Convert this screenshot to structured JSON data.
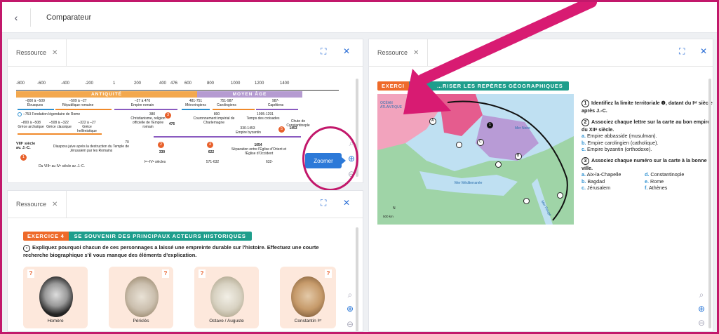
{
  "topbar": {
    "back_icon": "chevron-left-icon",
    "title": "Comparateur"
  },
  "tab_label": "Ressource",
  "tab_close": "✕",
  "zoom_button_label": "Zoomer",
  "timeline": {
    "ticks": [
      "-800",
      "-600",
      "-400",
      "-200",
      "1",
      "200",
      "400",
      "476",
      "600",
      "800",
      "1000",
      "1200",
      "1400"
    ],
    "period_antiquite": "ANTIQUITÉ",
    "period_moyen_age": "MOYEN ÂGE",
    "ranges": [
      {
        "dates": "–800 à –509",
        "label": "Étrusques"
      },
      {
        "dates": "–509 à –27",
        "label": "République romaine"
      },
      {
        "dates": "–27 à 476",
        "label": "Empire romain"
      },
      {
        "dates": "481-751",
        "label": "Mérovingiens"
      },
      {
        "dates": "751-987",
        "label": "Carolingiens"
      },
      {
        "dates": "987-",
        "label": "Capétiens"
      }
    ],
    "events": {
      "rome": "–753 Fondation légendaire de Rome",
      "greece_a": "–800 à –508",
      "greece_a_label": "Grèce archaïque",
      "greece_c": "–508 à –322",
      "greece_c_label": "Grèce classique",
      "greece_h": "–322 à –27",
      "greece_h_label": "Grèce hellénistique",
      "y380": "380",
      "christianisme": "Christianisme, religion officielle de l'Empire romain",
      "y476": "476",
      "y800": "800",
      "couronnement": "Couronnement impérial de Charlemagne",
      "crusades": "1095-1291",
      "crusades_label": "Temps des croisades",
      "byz": "330-1453",
      "byz_label": "Empire byzantin",
      "y1453": "1453",
      "constantinople": "Chute de Constantinople",
      "viii": "VIIIᵉ siècle av. J.-C.",
      "y70": "70",
      "diaspora": "Diaspora juive après la destruction du Temple de Jérusalem par les Romains",
      "y330": "330",
      "y622": "622",
      "y1054": "1054",
      "schisme": "Séparation entre l'Église d'Orient et l'Église d'Occident",
      "n1": "1",
      "n2": "2",
      "n3": "3",
      "n4": "4",
      "n5": "5",
      "bottom1": "Du VIIIᵉ au IVᵉ siècle av. J.-C.",
      "bottom2": "Iᵉʳ–IVᵉ siècles",
      "bottom3": "571-632",
      "bottom4": "632-"
    }
  },
  "exercise4": {
    "num": "EXERCICE 4",
    "title": "SE SOUVENIR DES PRINCIPAUX ACTEURS HISTORIQUES",
    "instruction": "Expliquez pourquoi chacun de ces personnages a laissé une empreinte durable sur l'histoire. Effectuez une courte recherche biographique s'il vous manque des éléments d'explication.",
    "q_mark": "?",
    "people": [
      "Homère",
      "Périclès",
      "Octave / Auguste",
      "Constantin Iᵉʳ"
    ]
  },
  "exercise_map": {
    "num": "EXERCI",
    "title": "…RISER LES REPÈRES GÉOGRAPHIQUES",
    "q1_num": "1",
    "q1": "Identifiez la limite territoriale ❶, datant du Iᵉʳ siècle après J.-C.",
    "q2_num": "2",
    "q2": "Associez chaque lettre sur la carte au bon empire du XIIᵉ siècle.",
    "q2_opts": [
      {
        "letter": "a.",
        "text": "Empire abbasside (musulman)."
      },
      {
        "letter": "b.",
        "text": "Empire carolingien (catholique)."
      },
      {
        "letter": "c.",
        "text": "Empire byzantin (orthodoxe)."
      }
    ],
    "q3_num": "3",
    "q3": "Associez chaque numéro sur la carte à la bonne ville.",
    "q3_opts": [
      {
        "letter": "a.",
        "text": "Aix-la-Chapelle"
      },
      {
        "letter": "d.",
        "text": "Constantinople"
      },
      {
        "letter": "b.",
        "text": "Bagdad"
      },
      {
        "letter": "e.",
        "text": "Rome"
      },
      {
        "letter": "c.",
        "text": "Jérusalem"
      },
      {
        "letter": "f.",
        "text": "Athènes"
      }
    ],
    "map_labels": {
      "ocean": "OCÉAN ATLANTIQUE",
      "mer_noire": "Mer Noire",
      "mer_med": "Mer Méditerranée",
      "mer_rouge": "Mer Rouge",
      "scale": "500 km",
      "north": "N",
      "markers": [
        "A",
        "B",
        "C",
        "1",
        "2",
        "3",
        "4",
        "5",
        "6"
      ]
    }
  },
  "colors": {
    "accent": "#c2186b",
    "blue": "#2c79d8",
    "orange": "#ee6a2a",
    "teal": "#1e9e8c"
  }
}
